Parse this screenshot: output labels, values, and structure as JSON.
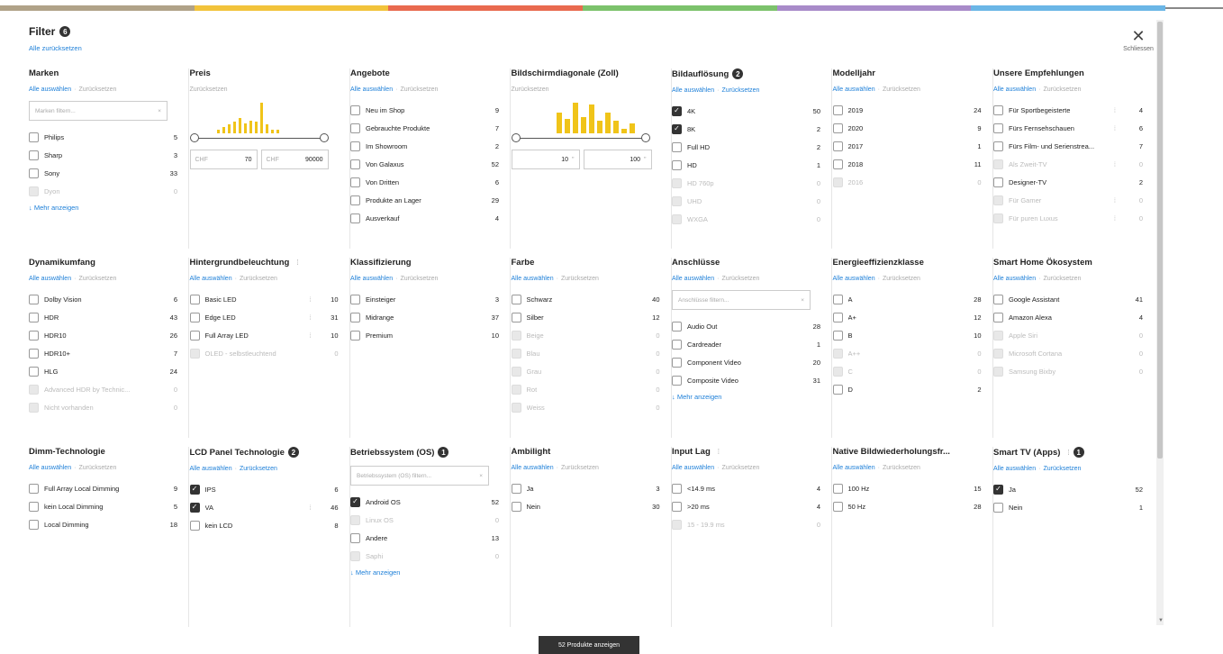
{
  "colors": {
    "stripe": [
      "#b0a288",
      "#f2c33b",
      "#e96a4f",
      "#7cc26c",
      "#a88bc9",
      "#6bb6e6"
    ],
    "accent": "#1d7fd8",
    "histogram": "#f0c419"
  },
  "header": {
    "title": "Filter",
    "active_count": "6",
    "reset_all": "Alle zurücksetzen",
    "close_label": "Schliessen",
    "close_icon": "close-icon"
  },
  "common": {
    "select_all": "Alle auswählen",
    "reset": "Zurücksetzen",
    "more": "Mehr anzeigen"
  },
  "footer": {
    "show_button": "52 Produkte anzeigen"
  },
  "rows": [
    {
      "columns": [
        {
          "title": "Marken",
          "type": "list",
          "filter_placeholder": "Marken filtern...",
          "items": [
            {
              "label": "Philips",
              "count": "5",
              "checked": false,
              "disabled": false
            },
            {
              "label": "Sharp",
              "count": "3",
              "checked": false,
              "disabled": false
            },
            {
              "label": "Sony",
              "count": "33",
              "checked": false,
              "disabled": false
            },
            {
              "label": "Dyon",
              "count": "0",
              "checked": false,
              "disabled": true
            }
          ],
          "more": true
        },
        {
          "title": "Preis",
          "type": "price",
          "currency": "CHF",
          "min": "70",
          "max": "90000",
          "histogram": [
            3,
            5,
            7,
            9,
            12,
            8,
            10,
            9,
            24,
            7,
            3,
            3
          ]
        },
        {
          "title": "Angebote",
          "type": "list",
          "items": [
            {
              "label": "Neu im Shop",
              "count": "9",
              "checked": false,
              "disabled": false
            },
            {
              "label": "Gebrauchte Produkte",
              "count": "7",
              "checked": false,
              "disabled": false
            },
            {
              "label": "Im Showroom",
              "count": "2",
              "checked": false,
              "disabled": false
            },
            {
              "label": "Von Galaxus",
              "count": "52",
              "checked": false,
              "disabled": false
            },
            {
              "label": "Von Dritten",
              "count": "6",
              "checked": false,
              "disabled": false
            },
            {
              "label": "Produkte an Lager",
              "count": "29",
              "checked": false,
              "disabled": false
            },
            {
              "label": "Ausverkauf",
              "count": "4",
              "checked": false,
              "disabled": false
            }
          ]
        },
        {
          "title": "Bildschirmdiagonale (Zoll)",
          "type": "range",
          "min": "10",
          "max": "100",
          "unit": "\"",
          "histogram": [
            20,
            14,
            30,
            16,
            28,
            12,
            20,
            12,
            4,
            10
          ]
        },
        {
          "title": "Bildauflösung",
          "badge": "2",
          "type": "list",
          "reset_active": true,
          "items": [
            {
              "label": "4K",
              "count": "50",
              "checked": true,
              "disabled": false
            },
            {
              "label": "8K",
              "count": "2",
              "checked": true,
              "disabled": false
            },
            {
              "label": "Full HD",
              "count": "2",
              "checked": false,
              "disabled": false
            },
            {
              "label": "HD",
              "count": "1",
              "checked": false,
              "disabled": false
            },
            {
              "label": "HD 760p",
              "count": "0",
              "checked": false,
              "disabled": true
            },
            {
              "label": "UHD",
              "count": "0",
              "checked": false,
              "disabled": true
            },
            {
              "label": "WXGA",
              "count": "0",
              "checked": false,
              "disabled": true
            }
          ]
        },
        {
          "title": "Modelljahr",
          "type": "list",
          "items": [
            {
              "label": "2019",
              "count": "24",
              "checked": false,
              "disabled": false
            },
            {
              "label": "2020",
              "count": "9",
              "checked": false,
              "disabled": false
            },
            {
              "label": "2017",
              "count": "1",
              "checked": false,
              "disabled": false
            },
            {
              "label": "2018",
              "count": "11",
              "checked": false,
              "disabled": false
            },
            {
              "label": "2016",
              "count": "0",
              "checked": false,
              "disabled": true
            }
          ]
        },
        {
          "title": "Unsere Empfehlungen",
          "type": "list",
          "items": [
            {
              "label": "Für Sportbegeisterte",
              "count": "4",
              "checked": false,
              "disabled": false,
              "info": true
            },
            {
              "label": "Fürs Fernsehschauen",
              "count": "6",
              "checked": false,
              "disabled": false,
              "info": true
            },
            {
              "label": "Fürs Film- und Serienstrea...",
              "count": "7",
              "checked": false,
              "disabled": false
            },
            {
              "label": "Als Zweit-TV",
              "count": "0",
              "checked": false,
              "disabled": true,
              "info": true
            },
            {
              "label": "Designer-TV",
              "count": "2",
              "checked": false,
              "disabled": false
            },
            {
              "label": "Für Gamer",
              "count": "0",
              "checked": false,
              "disabled": true,
              "info": true
            },
            {
              "label": "Für puren Luxus",
              "count": "0",
              "checked": false,
              "disabled": true,
              "info": true
            }
          ]
        }
      ]
    },
    {
      "columns": [
        {
          "title": "Dynamikumfang",
          "type": "list",
          "items": [
            {
              "label": "Dolby Vision",
              "count": "6",
              "checked": false,
              "disabled": false
            },
            {
              "label": "HDR",
              "count": "43",
              "checked": false,
              "disabled": false
            },
            {
              "label": "HDR10",
              "count": "26",
              "checked": false,
              "disabled": false
            },
            {
              "label": "HDR10+",
              "count": "7",
              "checked": false,
              "disabled": false
            },
            {
              "label": "HLG",
              "count": "24",
              "checked": false,
              "disabled": false
            },
            {
              "label": "Advanced HDR by Technic...",
              "count": "0",
              "checked": false,
              "disabled": true
            },
            {
              "label": "Nicht vorhanden",
              "count": "0",
              "checked": false,
              "disabled": true
            }
          ]
        },
        {
          "title": "Hintergrundbeleuchtung",
          "title_info": true,
          "type": "list",
          "items": [
            {
              "label": "Basic LED",
              "count": "10",
              "checked": false,
              "disabled": false,
              "info": true
            },
            {
              "label": "Edge LED",
              "count": "31",
              "checked": false,
              "disabled": false,
              "info": true
            },
            {
              "label": "Full Array LED",
              "count": "10",
              "checked": false,
              "disabled": false,
              "info": true
            },
            {
              "label": "OLED - selbstleuchtend",
              "count": "0",
              "checked": false,
              "disabled": true
            }
          ]
        },
        {
          "title": "Klassifizierung",
          "type": "list",
          "items": [
            {
              "label": "Einsteiger",
              "count": "3",
              "checked": false,
              "disabled": false
            },
            {
              "label": "Midrange",
              "count": "37",
              "checked": false,
              "disabled": false
            },
            {
              "label": "Premium",
              "count": "10",
              "checked": false,
              "disabled": false
            }
          ]
        },
        {
          "title": "Farbe",
          "type": "list",
          "items": [
            {
              "label": "Schwarz",
              "count": "40",
              "checked": false,
              "disabled": false
            },
            {
              "label": "Silber",
              "count": "12",
              "checked": false,
              "disabled": false
            },
            {
              "label": "Beige",
              "count": "0",
              "checked": false,
              "disabled": true
            },
            {
              "label": "Blau",
              "count": "0",
              "checked": false,
              "disabled": true
            },
            {
              "label": "Grau",
              "count": "0",
              "checked": false,
              "disabled": true
            },
            {
              "label": "Rot",
              "count": "0",
              "checked": false,
              "disabled": true
            },
            {
              "label": "Weiss",
              "count": "0",
              "checked": false,
              "disabled": true
            }
          ]
        },
        {
          "title": "Anschlüsse",
          "type": "list",
          "filter_placeholder": "Anschlüsse filtern...",
          "items": [
            {
              "label": "Audio Out",
              "count": "28",
              "checked": false,
              "disabled": false
            },
            {
              "label": "Cardreader",
              "count": "1",
              "checked": false,
              "disabled": false
            },
            {
              "label": "Component Video",
              "count": "20",
              "checked": false,
              "disabled": false
            },
            {
              "label": "Composite Video",
              "count": "31",
              "checked": false,
              "disabled": false
            }
          ],
          "more": true
        },
        {
          "title": "Energieeffizienzklasse",
          "type": "list",
          "items": [
            {
              "label": "A",
              "count": "28",
              "checked": false,
              "disabled": false
            },
            {
              "label": "A+",
              "count": "12",
              "checked": false,
              "disabled": false
            },
            {
              "label": "B",
              "count": "10",
              "checked": false,
              "disabled": false
            },
            {
              "label": "A++",
              "count": "0",
              "checked": false,
              "disabled": true
            },
            {
              "label": "C",
              "count": "0",
              "checked": false,
              "disabled": true
            },
            {
              "label": "D",
              "count": "2",
              "checked": false,
              "disabled": false
            }
          ]
        },
        {
          "title": "Smart Home Ökosystem",
          "type": "list",
          "items": [
            {
              "label": "Google Assistant",
              "count": "41",
              "checked": false,
              "disabled": false
            },
            {
              "label": "Amazon Alexa",
              "count": "4",
              "checked": false,
              "disabled": false
            },
            {
              "label": "Apple Siri",
              "count": "0",
              "checked": false,
              "disabled": true
            },
            {
              "label": "Microsoft Cortana",
              "count": "0",
              "checked": false,
              "disabled": true
            },
            {
              "label": "Samsung Bixby",
              "count": "0",
              "checked": false,
              "disabled": true
            }
          ]
        }
      ]
    },
    {
      "columns": [
        {
          "title": "Dimm-Technologie",
          "type": "list",
          "items": [
            {
              "label": "Full Array Local Dimming",
              "count": "9",
              "checked": false,
              "disabled": false
            },
            {
              "label": "kein Local Dimming",
              "count": "5",
              "checked": false,
              "disabled": false
            },
            {
              "label": "Local Dimming",
              "count": "18",
              "checked": false,
              "disabled": false
            }
          ]
        },
        {
          "title": "LCD Panel Technologie",
          "badge": "2",
          "type": "list",
          "reset_active": true,
          "items": [
            {
              "label": "IPS",
              "count": "6",
              "checked": true,
              "disabled": false
            },
            {
              "label": "VA",
              "count": "46",
              "checked": true,
              "disabled": false,
              "info": true
            },
            {
              "label": "kein LCD",
              "count": "8",
              "checked": false,
              "disabled": false
            }
          ]
        },
        {
          "title": "Betriebssystem (OS)",
          "badge": "1",
          "type": "list",
          "no_links": true,
          "filter_placeholder": "Betriebssystem (OS) filtern...",
          "items": [
            {
              "label": "Android OS",
              "count": "52",
              "checked": true,
              "disabled": false
            },
            {
              "label": "Linux OS",
              "count": "0",
              "checked": false,
              "disabled": true
            },
            {
              "label": "Andere",
              "count": "13",
              "checked": false,
              "disabled": false
            },
            {
              "label": "Saphi",
              "count": "0",
              "checked": false,
              "disabled": true
            }
          ],
          "more": true
        },
        {
          "title": "Ambilight",
          "type": "list",
          "items": [
            {
              "label": "Ja",
              "count": "3",
              "checked": false,
              "disabled": false
            },
            {
              "label": "Nein",
              "count": "30",
              "checked": false,
              "disabled": false
            }
          ]
        },
        {
          "title": "Input Lag",
          "title_info": true,
          "type": "list",
          "items": [
            {
              "label": "<14.9 ms",
              "count": "4",
              "checked": false,
              "disabled": false
            },
            {
              "label": ">20 ms",
              "count": "4",
              "checked": false,
              "disabled": false
            },
            {
              "label": "15 - 19.9 ms",
              "count": "0",
              "checked": false,
              "disabled": true
            }
          ]
        },
        {
          "title": "Native Bildwiederholungsfr...",
          "type": "list",
          "items": [
            {
              "label": "100 Hz",
              "count": "15",
              "checked": false,
              "disabled": false
            },
            {
              "label": "50 Hz",
              "count": "28",
              "checked": false,
              "disabled": false
            }
          ]
        },
        {
          "title": "Smart TV (Apps)",
          "badge": "1",
          "title_info": true,
          "type": "list",
          "reset_active": true,
          "items": [
            {
              "label": "Ja",
              "count": "52",
              "checked": true,
              "disabled": false
            },
            {
              "label": "Nein",
              "count": "1",
              "checked": false,
              "disabled": false
            }
          ]
        }
      ]
    }
  ]
}
